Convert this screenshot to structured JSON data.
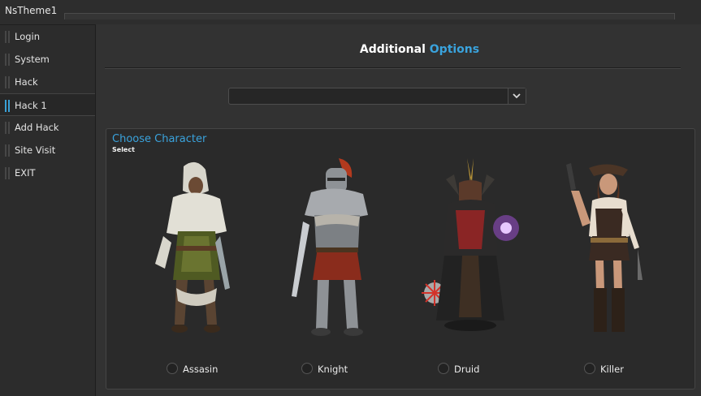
{
  "window": {
    "title": "NsTheme1"
  },
  "sidebar": {
    "items": [
      {
        "label": "Login"
      },
      {
        "label": "System"
      },
      {
        "label": "Hack"
      },
      {
        "label": "Hack 1",
        "active": true
      },
      {
        "label": "Add Hack"
      },
      {
        "label": "Site Visit"
      },
      {
        "label": "EXIT"
      }
    ]
  },
  "main": {
    "heading_part1": "Additional",
    "heading_part2": "Options",
    "dropdown": {
      "value": "",
      "icon": "chevron-down-icon"
    }
  },
  "panel": {
    "title": "Choose Character",
    "subtitle": "Select",
    "characters": [
      {
        "name": "Assasin",
        "icon": "assassin-portrait"
      },
      {
        "name": "Knight",
        "icon": "knight-portrait"
      },
      {
        "name": "Druid",
        "icon": "druid-portrait"
      },
      {
        "name": "Killer",
        "icon": "killer-portrait"
      }
    ]
  },
  "colors": {
    "accent": "#3aa3dd",
    "background": "#313131",
    "panel": "#2a2a2a",
    "sidebar": "#2c2c2c"
  }
}
